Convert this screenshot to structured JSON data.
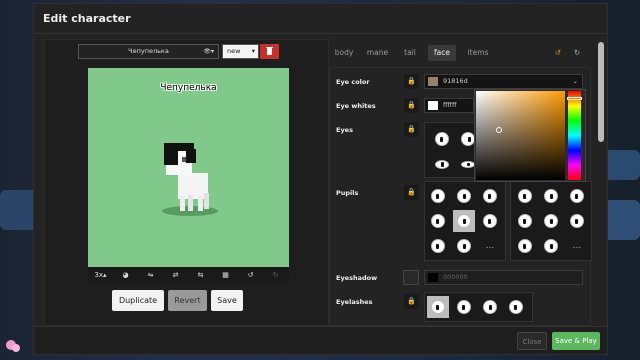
{
  "modal": {
    "title": "Edit character",
    "footer": {
      "close_label": "Close",
      "save_play_label": "Save & Play"
    }
  },
  "left_panel": {
    "character_select": {
      "value": "Чепупелька",
      "icon_name": "eye-slash-icon"
    },
    "mode_select": {
      "value": "new"
    },
    "delete_icon": "trash-icon",
    "preview_name": "Чепупелька",
    "toolbar": {
      "zoom_label": "3x",
      "icons": [
        "palette-icon",
        "flip-horizontal-icon",
        "swap-icon",
        "grid-icon",
        "undo-icon",
        "redo-icon"
      ]
    },
    "actions": {
      "duplicate_label": "Duplicate",
      "revert_label": "Revert",
      "save_label": "Save"
    }
  },
  "right_panel": {
    "tabs": [
      {
        "label": "body"
      },
      {
        "label": "mane"
      },
      {
        "label": "tail"
      },
      {
        "label": "face",
        "active": true
      },
      {
        "label": "items"
      }
    ],
    "rows": {
      "eye_color": {
        "label": "Eye color",
        "value": "91816d",
        "color": "#91816d"
      },
      "eye_whites": {
        "label": "Eye whites",
        "value": "ffffff",
        "color": "#ffffff"
      },
      "eyes": {
        "label": "Eyes"
      },
      "pupils": {
        "label": "Pupils",
        "more": "..."
      },
      "eyeshadow": {
        "label": "Eyeshadow",
        "value": "000000",
        "color": "#000000"
      },
      "eyelashes": {
        "label": "Eyelashes"
      }
    }
  },
  "colors": {
    "accent_green": "#5cb85c",
    "delete_red": "#c9302c",
    "preview_bg": "#80c98b",
    "undo_orange": "#e8842b"
  }
}
